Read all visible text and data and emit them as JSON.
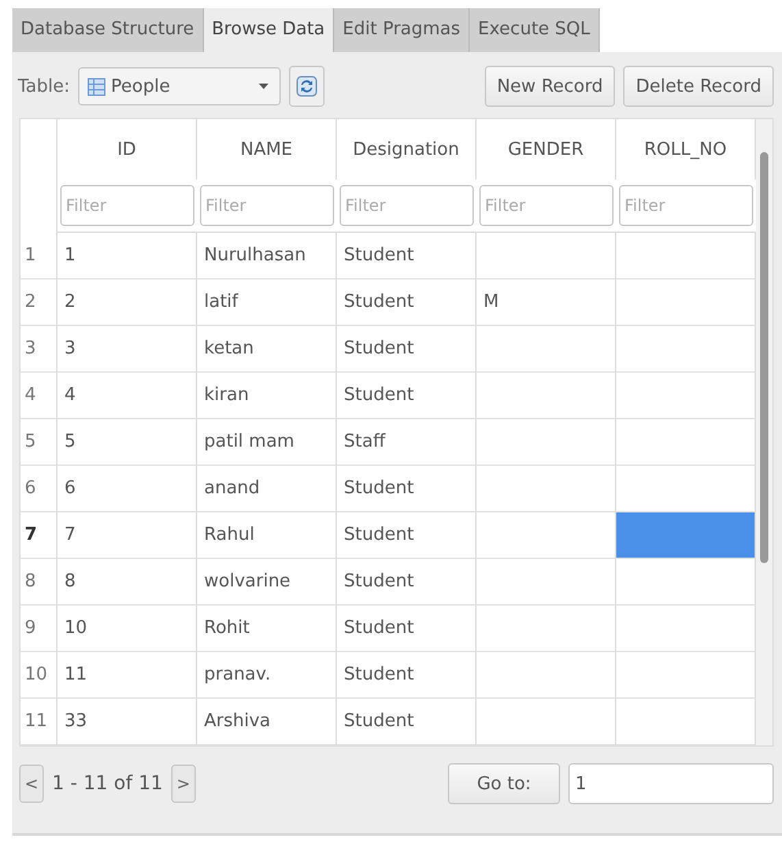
{
  "tabs": [
    {
      "label": "Database Structure",
      "selected": false
    },
    {
      "label": "Browse Data",
      "selected": true
    },
    {
      "label": "Edit Pragmas",
      "selected": false
    },
    {
      "label": "Execute SQL",
      "selected": false
    }
  ],
  "toolbar": {
    "table_label": "Table:",
    "table_select": "People",
    "buttons": [
      "New Record",
      "Delete Record"
    ]
  },
  "table": {
    "columns": [
      {
        "label": "ID",
        "filter_placeholder": "Filter"
      },
      {
        "label": "NAME",
        "filter_placeholder": "Filter"
      },
      {
        "label": "Designation",
        "filter_placeholder": "Filter"
      },
      {
        "label": "GENDER",
        "filter_placeholder": "Filter"
      },
      {
        "label": "ROLL_NO",
        "filter_placeholder": "Filter"
      }
    ],
    "rows": [
      {
        "row_number": "1",
        "selected": false,
        "cells": [
          {
            "text": "1",
            "selected": false
          },
          {
            "text": "Nurulhasan",
            "selected": false
          },
          {
            "text": "Student",
            "selected": false
          },
          {
            "selected": false
          },
          {
            "selected": false
          }
        ]
      },
      {
        "row_number": "2",
        "selected": false,
        "cells": [
          {
            "text": "2",
            "selected": false
          },
          {
            "text": "latif",
            "selected": false
          },
          {
            "text": "Student",
            "selected": false
          },
          {
            "text": "M",
            "selected": false
          },
          {
            "selected": false
          }
        ]
      },
      {
        "row_number": "3",
        "selected": false,
        "cells": [
          {
            "text": "3",
            "selected": false
          },
          {
            "text": "ketan",
            "selected": false
          },
          {
            "text": "Student",
            "selected": false
          },
          {
            "selected": false
          },
          {
            "selected": false
          }
        ]
      },
      {
        "row_number": "4",
        "selected": false,
        "cells": [
          {
            "text": "4",
            "selected": false
          },
          {
            "text": "kiran",
            "selected": false
          },
          {
            "text": "Student",
            "selected": false
          },
          {
            "selected": false
          },
          {
            "selected": false
          }
        ]
      },
      {
        "row_number": "5",
        "selected": false,
        "cells": [
          {
            "text": "5",
            "selected": false
          },
          {
            "text": "patil mam",
            "selected": false
          },
          {
            "text": "Staff",
            "selected": false
          },
          {
            "selected": false
          },
          {
            "selected": false
          }
        ]
      },
      {
        "row_number": "6",
        "selected": false,
        "cells": [
          {
            "text": "6",
            "selected": false
          },
          {
            "text": "anand",
            "selected": false
          },
          {
            "text": "Student",
            "selected": false
          },
          {
            "selected": false
          },
          {
            "selected": false
          }
        ]
      },
      {
        "row_number": "7",
        "selected": true,
        "cells": [
          {
            "text": "7",
            "selected": false
          },
          {
            "text": "Rahul",
            "selected": false
          },
          {
            "text": "Student",
            "selected": false
          },
          {
            "selected": false
          },
          {
            "selected": true
          }
        ]
      },
      {
        "row_number": "8",
        "selected": false,
        "cells": [
          {
            "text": "8",
            "selected": false
          },
          {
            "text": "wolvarine",
            "selected": false
          },
          {
            "text": "Student",
            "selected": false
          },
          {
            "selected": false
          },
          {
            "selected": false
          }
        ]
      },
      {
        "row_number": "9",
        "selected": false,
        "cells": [
          {
            "text": "10",
            "selected": false
          },
          {
            "text": "Rohit",
            "selected": false
          },
          {
            "text": "Student",
            "selected": false
          },
          {
            "selected": false
          },
          {
            "selected": false
          }
        ]
      },
      {
        "row_number": "10",
        "selected": false,
        "cells": [
          {
            "text": "11",
            "selected": false
          },
          {
            "text": "pranav.",
            "selected": false
          },
          {
            "text": "Student",
            "selected": false
          },
          {
            "selected": false
          },
          {
            "selected": false
          }
        ]
      },
      {
        "row_number": "11",
        "selected": false,
        "cells": [
          {
            "text": "33",
            "selected": false
          },
          {
            "text": "Arshiva",
            "selected": false
          },
          {
            "text": "Student",
            "selected": false
          },
          {
            "selected": false
          },
          {
            "selected": false
          }
        ]
      }
    ]
  },
  "pager": {
    "prev": "<",
    "range": "1 - 11 of 11",
    "next": ">",
    "goto_button": "Go to:",
    "goto_value": "1"
  }
}
